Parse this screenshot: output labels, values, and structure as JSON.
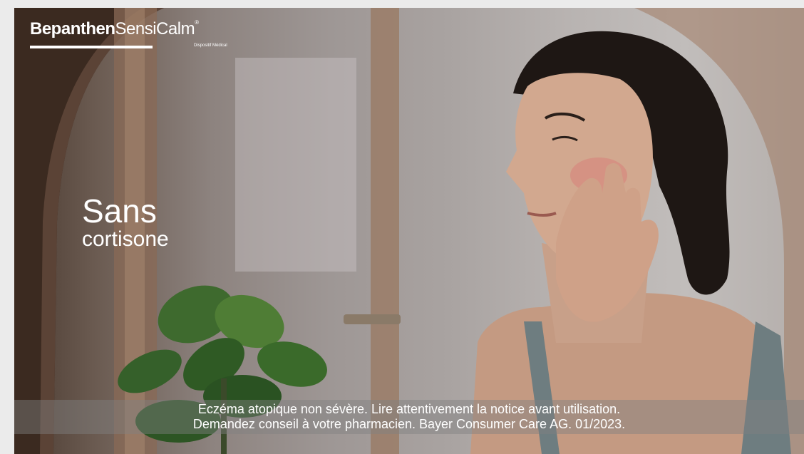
{
  "logo": {
    "brand": "Bepanthen",
    "product": "SensiCalm",
    "registered": "®",
    "subtitle": "Dispositif Médical"
  },
  "claim": {
    "line1": "Sans",
    "line2": "cortisone"
  },
  "disclaimer": {
    "line1": "Eczéma atopique non sévère. Lire attentivement la notice avant utilisation.",
    "line2": "Demandez conseil à votre pharmacien. Bayer Consumer Care AG. 01/2023."
  },
  "colors": {
    "text": "#ffffff",
    "banner": "#808080"
  }
}
